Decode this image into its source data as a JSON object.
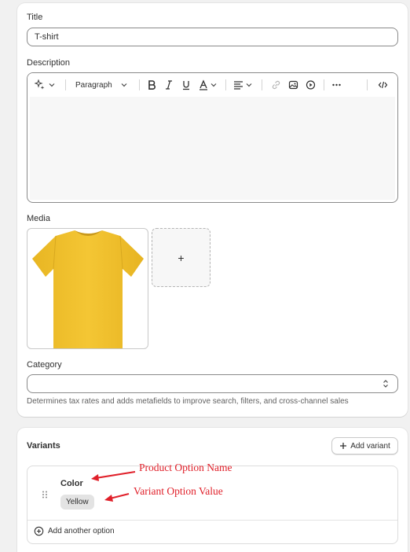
{
  "product": {
    "title_label": "Title",
    "title_value": "T-shirt",
    "description_label": "Description",
    "toolbar": {
      "paragraph_label": "Paragraph"
    },
    "media_label": "Media",
    "media_add_label": "+",
    "category_label": "Category",
    "category_value": "",
    "category_help": "Determines tax rates and adds metafields to improve search, filters, and cross-channel sales"
  },
  "variants": {
    "title": "Variants",
    "add_variant_label": "Add variant",
    "option_name": "Color",
    "option_value": "Yellow",
    "add_option_label": "Add another option"
  },
  "annotations": {
    "option_name_note": "Product Option Name",
    "option_value_note": "Variant Option Value",
    "color": "#e0202a"
  },
  "colors": {
    "tshirt": "#f2c230",
    "page_bg": "#f1f1f1"
  },
  "icons": [
    "magic-icon",
    "bold-icon",
    "italic-icon",
    "underline-icon",
    "text-color-icon",
    "align-icon",
    "link-icon",
    "image-icon",
    "video-icon",
    "more-icon",
    "code-icon",
    "select-chevron-icon",
    "drag-handle-icon",
    "plus-icon",
    "plus-circle-icon"
  ]
}
